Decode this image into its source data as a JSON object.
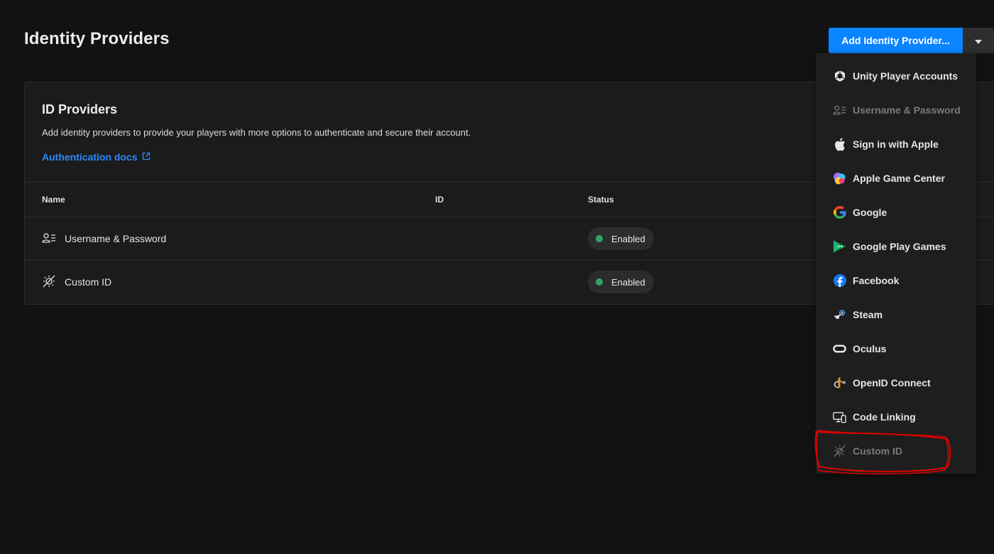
{
  "page": {
    "title": "Identity Providers"
  },
  "add_button": {
    "label": "Add Identity Provider..."
  },
  "card": {
    "title": "ID Providers",
    "description": "Add identity providers to provide your players with more options to authenticate and secure their account.",
    "docs_link": "Authentication docs"
  },
  "table": {
    "columns": {
      "name": "Name",
      "id": "ID",
      "status": "Status"
    },
    "rows": [
      {
        "name": "Username & Password",
        "id": "",
        "status": "Enabled",
        "icon": "user-list-icon"
      },
      {
        "name": "Custom ID",
        "id": "",
        "status": "Enabled",
        "icon": "custom-id-icon"
      }
    ]
  },
  "menu": {
    "items": [
      {
        "label": "Unity Player Accounts",
        "icon": "unity-icon",
        "disabled": false
      },
      {
        "label": "Username & Password",
        "icon": "user-list-icon",
        "disabled": true
      },
      {
        "label": "Sign in with Apple",
        "icon": "apple-icon",
        "disabled": false
      },
      {
        "label": "Apple Game Center",
        "icon": "game-center-icon",
        "disabled": false
      },
      {
        "label": "Google",
        "icon": "google-icon",
        "disabled": false
      },
      {
        "label": "Google Play Games",
        "icon": "google-play-games-icon",
        "disabled": false
      },
      {
        "label": "Facebook",
        "icon": "facebook-icon",
        "disabled": false
      },
      {
        "label": "Steam",
        "icon": "steam-icon",
        "disabled": false
      },
      {
        "label": "Oculus",
        "icon": "oculus-icon",
        "disabled": false
      },
      {
        "label": "OpenID Connect",
        "icon": "openid-icon",
        "disabled": false
      },
      {
        "label": "Code Linking",
        "icon": "code-linking-icon",
        "disabled": false
      },
      {
        "label": "Custom ID",
        "icon": "custom-id-icon",
        "disabled": true
      }
    ]
  },
  "colors": {
    "background": "#121212",
    "card": "#1b1b1b",
    "accent": "#0a84ff",
    "link": "#2b8cff",
    "status_enabled": "#2fa56a",
    "annotation": "#e00000"
  }
}
